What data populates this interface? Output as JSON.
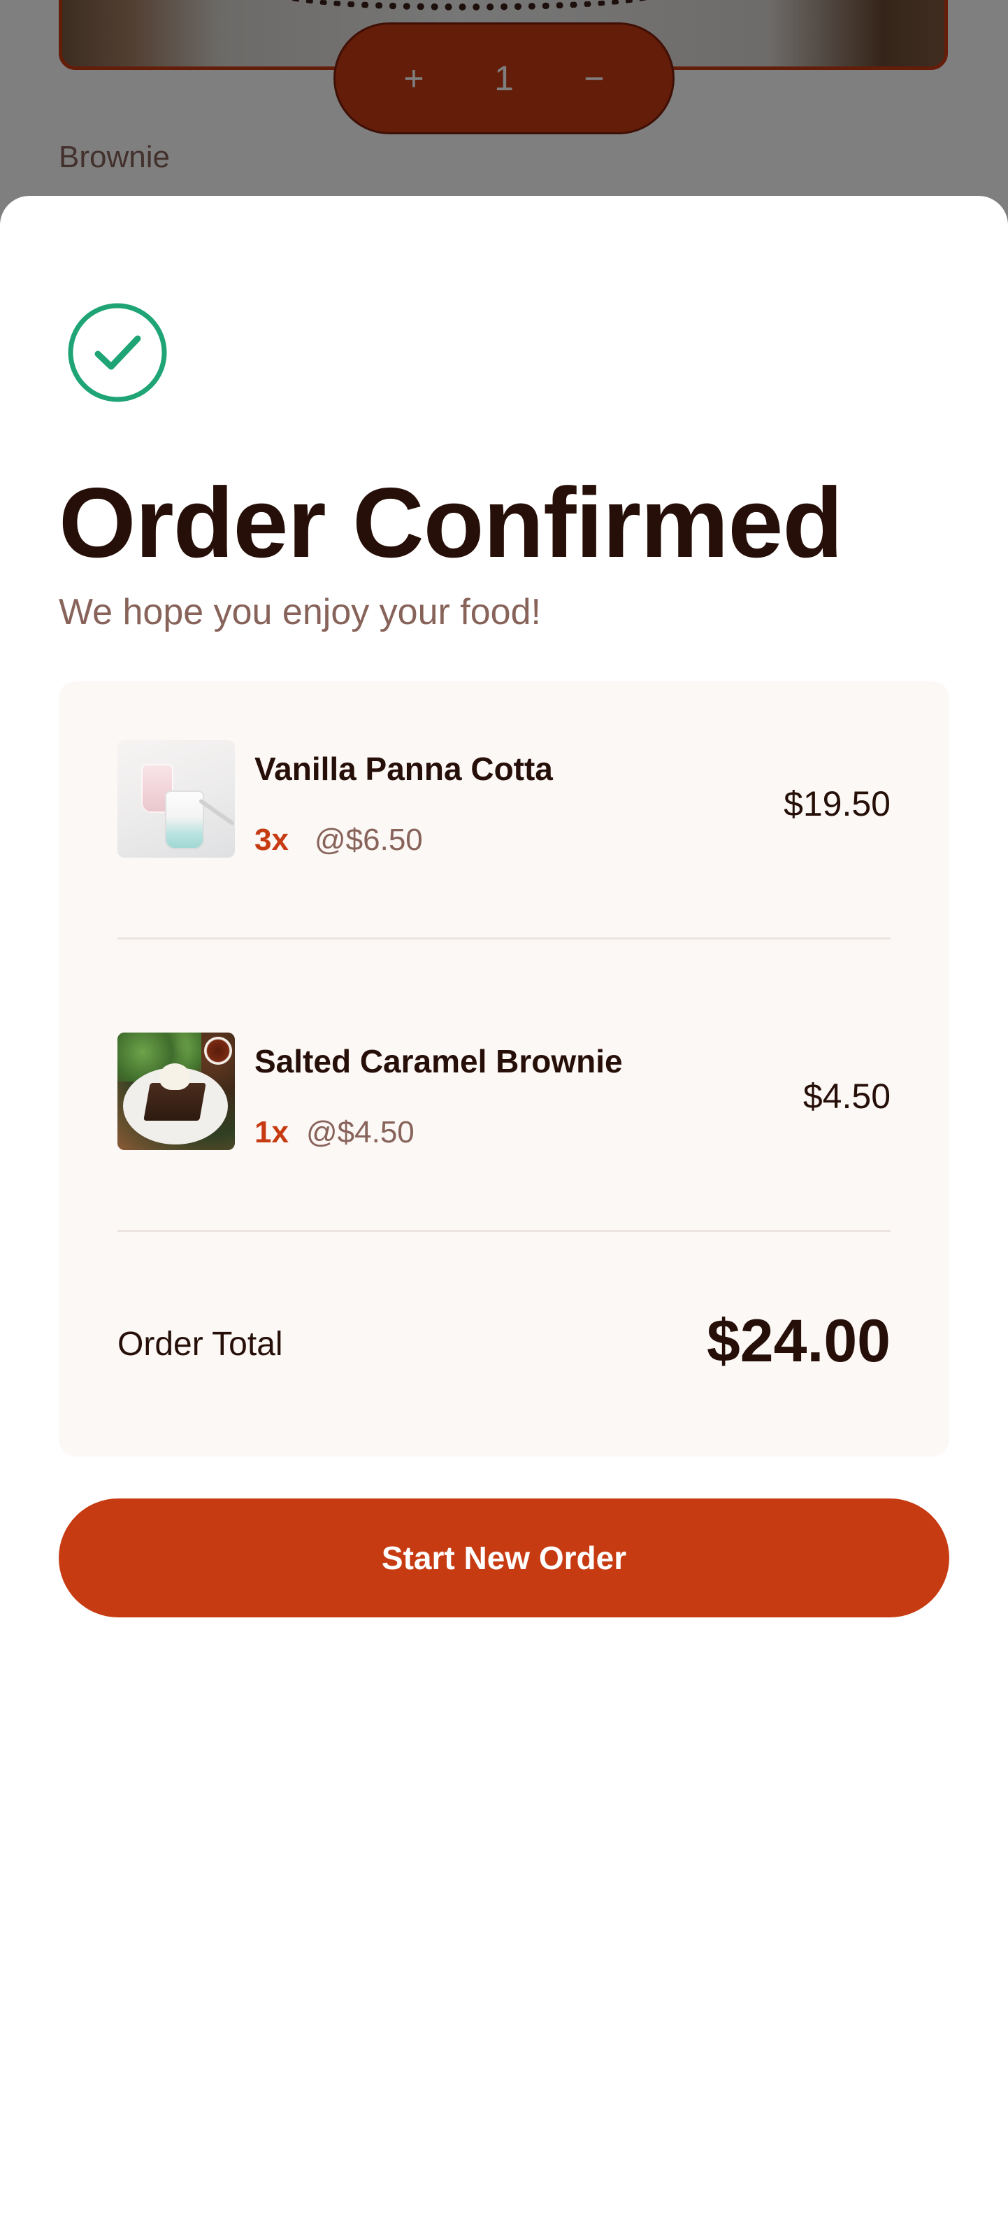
{
  "background": {
    "stepper": {
      "increment_icon": "+",
      "quantity": "1",
      "decrement_icon": "−"
    },
    "item_name": "Brownie"
  },
  "confirmation": {
    "icon": "check-circle-icon",
    "title": "Order Confirmed",
    "subtitle": "We hope you enjoy your food!",
    "items": [
      {
        "name": "Vanilla Panna Cotta",
        "quantity": "3x",
        "unit_price": "@$6.50",
        "total": "$19.50",
        "thumbnail": "panna-cotta-thumbnail"
      },
      {
        "name": "Salted Caramel Brownie",
        "quantity": "1x",
        "unit_price": "@$4.50",
        "total": "$4.50",
        "thumbnail": "brownie-thumbnail"
      }
    ],
    "total_label": "Order Total",
    "total_value": "$24.00",
    "button_label": "Start New Order"
  },
  "colors": {
    "accent": "#c73b12",
    "success": "#1ea475",
    "text_dark": "#260f08",
    "text_muted": "#87635a",
    "card_bg": "#fcf8f6"
  }
}
